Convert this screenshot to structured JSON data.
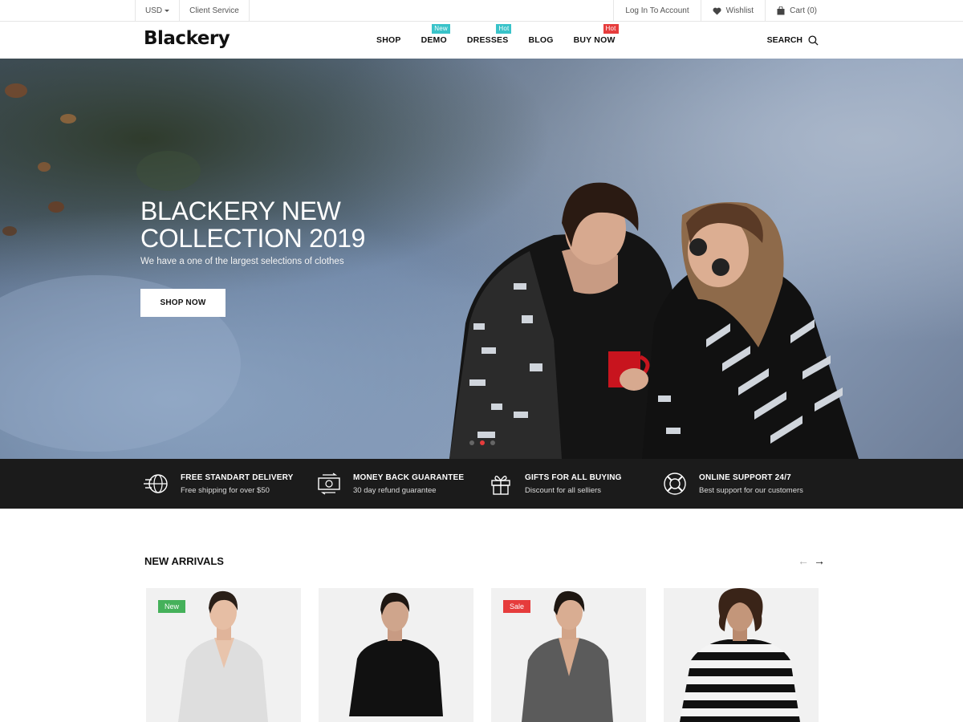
{
  "topbar": {
    "currency": "USD",
    "client_service": "Client Service",
    "login": "Log In To Account",
    "wishlist": "Wishlist",
    "cart": "Cart (0)"
  },
  "header": {
    "logo": "Blackery",
    "nav": [
      {
        "label": "SHOP",
        "badge": ""
      },
      {
        "label": "DEMO",
        "badge": "New"
      },
      {
        "label": "DRESSES",
        "badge": "Hot"
      },
      {
        "label": "BLOG",
        "badge": ""
      },
      {
        "label": "BUY NOW",
        "badge": "Hot"
      }
    ],
    "search": "SEARCH"
  },
  "hero": {
    "title_line1": "BLACKERY NEW",
    "title_line2": "COLLECTION 2019",
    "subtitle": "We have a one of the largest selections of clothes",
    "button": "SHOP NOW",
    "slides": 3,
    "active_slide": 2
  },
  "features": [
    {
      "title": "FREE STANDART DELIVERY",
      "subtitle": "Free shipping for over $50",
      "icon": "delivery-globe-icon"
    },
    {
      "title": "MONEY BACK GUARANTEE",
      "subtitle": "30 day refund guarantee",
      "icon": "money-back-icon"
    },
    {
      "title": "GIFTS FOR ALL BUYING",
      "subtitle": "Discount for all selliers",
      "icon": "gift-icon"
    },
    {
      "title": "ONLINE SUPPORT 24/7",
      "subtitle": "Best support for our customers",
      "icon": "lifebuoy-icon"
    }
  ],
  "arrivals": {
    "title": "NEW ARRIVALS",
    "products": [
      {
        "tag": "New",
        "tag_type": "new",
        "garment_color": "#dcdcdc"
      },
      {
        "tag": "",
        "tag_type": "",
        "garment_color": "#111111"
      },
      {
        "tag": "Sale",
        "tag_type": "sale",
        "garment_color": "#5a5a5a"
      },
      {
        "tag": "",
        "tag_type": "",
        "garment_color": "stripes"
      }
    ]
  },
  "colors": {
    "accent_red": "#e63c3c",
    "accent_teal": "#39c3c9",
    "tag_green": "#45b15a",
    "feature_bar": "#1b1b1b"
  }
}
